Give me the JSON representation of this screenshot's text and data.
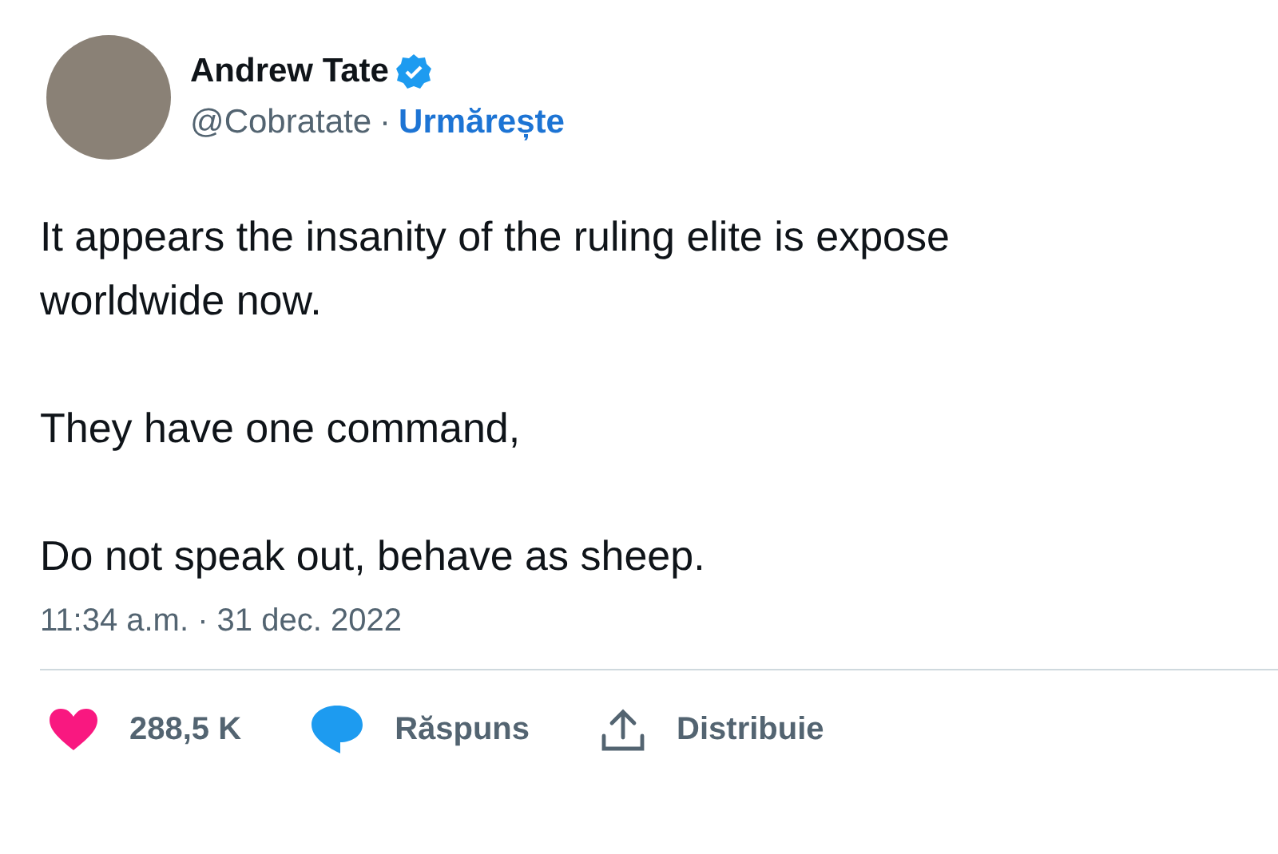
{
  "author": {
    "name": "Andrew Tate",
    "verified": true,
    "handle": "@Cobratate",
    "separator": "·",
    "follow_label": "Urmărește"
  },
  "paragraphs": [
    [
      "It appears the insanity of the ruling elite is expose",
      "worldwide now."
    ],
    [
      "They have one command,"
    ],
    [
      "Do not speak out, behave as sheep."
    ]
  ],
  "timestamp": "11:34 a.m. · 31 dec. 2022",
  "actions": [
    {
      "kind": "like",
      "label": "288,5 K"
    },
    {
      "kind": "reply",
      "label": "Răspuns"
    },
    {
      "kind": "share",
      "label": "Distribuie"
    }
  ]
}
